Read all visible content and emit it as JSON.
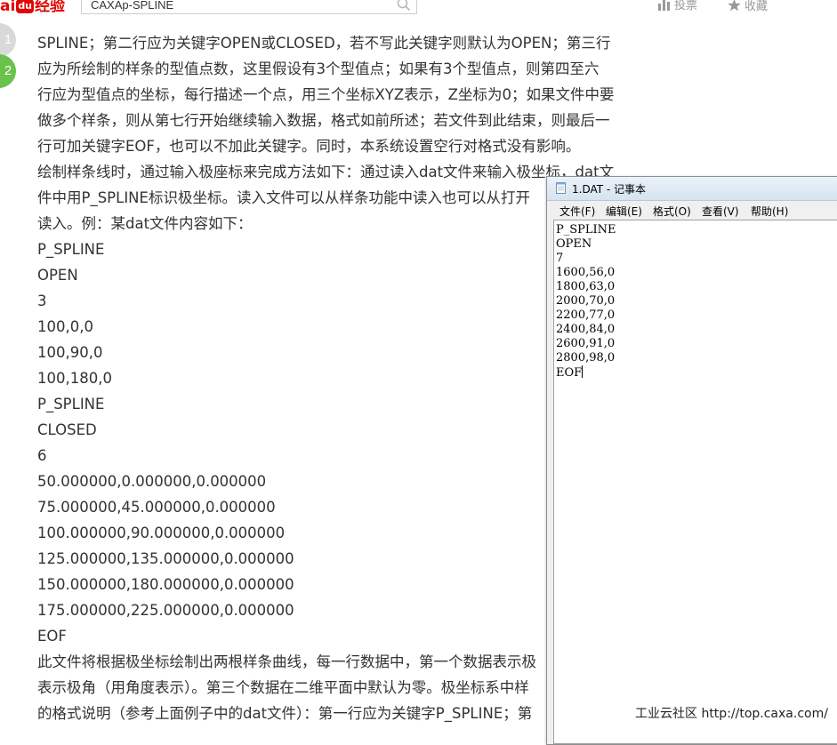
{
  "header": {
    "logo_text": "ai",
    "logo_paw": "du",
    "logo_suffix": "经验",
    "search_value": "CAXAp-SPLINE",
    "vote_label": "投票",
    "collect_label": "收藏"
  },
  "steps": [
    "1",
    "2"
  ],
  "article": {
    "lines": [
      "SPLINE；第二行应为关键字OPEN或CLOSED，若不写此关键字则默认为OPEN；第三行",
      "应为所绘制的样条的型值点数，这里假设有3个型值点；如果有3个型值点，则第四至六",
      "行应为型值点的坐标，每行描述一个点，用三个坐标XYZ表示，Z坐标为0；如果文件中要",
      "做多个样条，则从第七行开始继续输入数据，格式如前所述；若文件到此结束，则最后一",
      "行可加关键字EOF，也可以不加此关键字。同时，本系统设置空行对格式没有影响。",
      "绘制样条线时，通过输入极座标来完成方法如下：通过读入dat文件来输入极坐标，dat文",
      "件中用P_SPLINE标识极坐标。读入文件可以从样条功能中读入也可以从打开",
      "读入。例：某dat文件内容如下：",
      "P_SPLINE",
      "OPEN",
      "3",
      "100,0,0",
      "100,90,0",
      "100,180,0",
      "P_SPLINE",
      "CLOSED",
      "6",
      "50.000000,0.000000,0.000000",
      "75.000000,45.000000,0.000000",
      "100.000000,90.000000,0.000000",
      "125.000000,135.000000,0.000000",
      "150.000000,180.000000,0.000000",
      "175.000000,225.000000,0.000000",
      "EOF",
      "此文件将根据极坐标绘制出两根样条曲线，每一行数据中，第一个数据表示极",
      "表示极角（用角度表示）。第三个数据在二维平面中默认为零。极坐标系中样",
      "的格式说明（参考上面例子中的dat文件）：第一行应为关键字P_SPLINE；第"
    ]
  },
  "notepad": {
    "title": "1.DAT - 记事本",
    "menu": [
      "文件(F)",
      "编辑(E)",
      "格式(O)",
      "查看(V)",
      "帮助(H)"
    ],
    "lines": [
      "P_SPLINE",
      "OPEN",
      "7",
      "1600,56,0",
      "1800,63,0",
      "2000,70,0",
      "2200,77,0",
      "2400,84,0",
      "2600,91,0",
      "2800,98,0",
      "EOF"
    ]
  },
  "watermark": "工业云社区 http://top.caxa.com/"
}
